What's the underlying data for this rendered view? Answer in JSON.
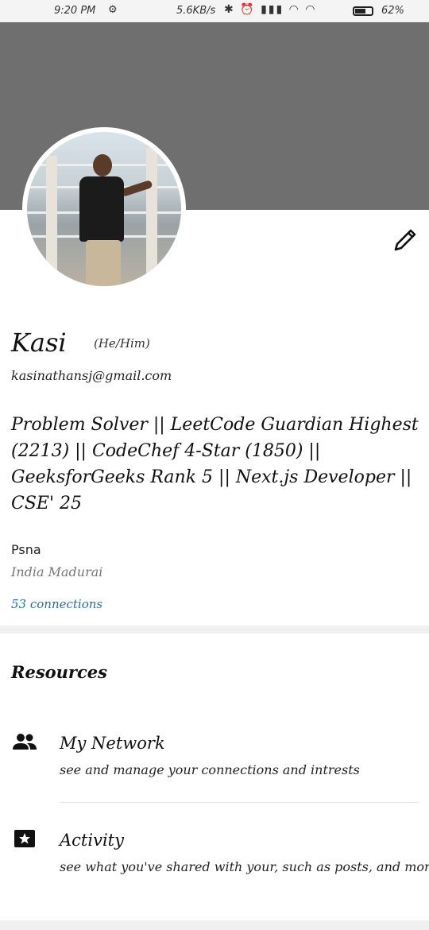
{
  "status_bar": {
    "time": "9:20 PM",
    "net_speed": "5.6KB/s",
    "battery": "62%"
  },
  "profile": {
    "name": "Kasi",
    "pronouns": "(He/Him)",
    "email": "kasinathansj@gmail.com",
    "headline": "Problem Solver || LeetCode Guardian Highest (2213)  || CodeChef 4-Star (1850) || GeeksforGeeks Rank 5 || Next.js Developer || CSE' 25",
    "organization": "Psna",
    "location": "India Madurai",
    "connections": "53 connections"
  },
  "resources": {
    "title": "Resources",
    "items": [
      {
        "icon": "people-icon",
        "title": "My Network",
        "description": "see and manage your connections and intrests"
      },
      {
        "icon": "star-ticket-icon",
        "title": "Activity",
        "description": "see what you've shared with your, such as posts, and more"
      }
    ]
  },
  "colors": {
    "cover": "#6f6f6f",
    "link": "#2a6f96",
    "separator": "#f0f0f0"
  }
}
